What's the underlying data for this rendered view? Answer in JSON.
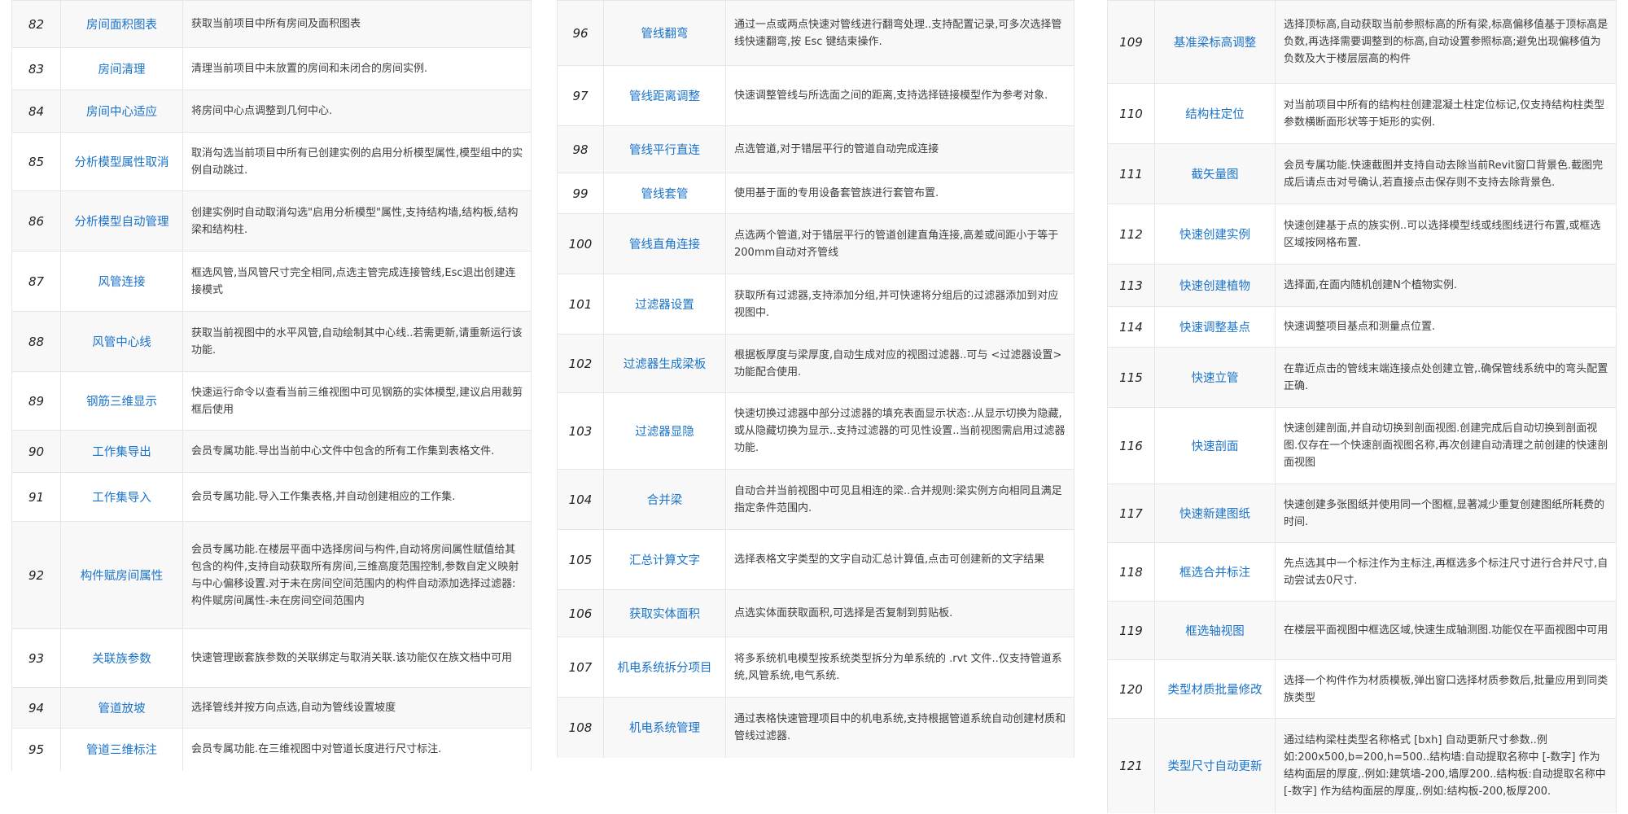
{
  "columns": [
    {
      "rows": [
        {
          "num": "82",
          "name": "房间面积图表",
          "desc": "获取当前项目中所有房间及面积图表"
        },
        {
          "num": "83",
          "name": "房间清理",
          "desc": "清理当前项目中未放置的房间和未闭合的房间实例."
        },
        {
          "num": "84",
          "name": "房间中心适应",
          "desc": "将房间中心点调整到几何中心."
        },
        {
          "num": "85",
          "name": "分析模型属性取消",
          "desc": "取消勾选当前项目中所有已创建实例的启用分析模型属性,模型组中的实例自动跳过."
        },
        {
          "num": "86",
          "name": "分析模型自动管理",
          "desc": "创建实例时自动取消勾选\"启用分析模型\"属性,支持结构墙,结构板,结构梁和结构柱."
        },
        {
          "num": "87",
          "name": "风管连接",
          "desc": "框选风管,当风管尺寸完全相同,点选主管完成连接管线,Esc退出创建连接模式"
        },
        {
          "num": "88",
          "name": "风管中心线",
          "desc": "获取当前视图中的水平风管,自动绘制其中心线..若需更新,请重新运行该功能."
        },
        {
          "num": "89",
          "name": "钢筋三维显示",
          "desc": "快速运行命令以查看当前三维视图中可见钢筋的实体模型,建议启用裁剪框后使用"
        },
        {
          "num": "90",
          "name": "工作集导出",
          "desc": "会员专属功能.导出当前中心文件中包含的所有工作集到表格文件."
        },
        {
          "num": "91",
          "name": "工作集导入",
          "desc": "会员专属功能.导入工作集表格,并自动创建相应的工作集."
        },
        {
          "num": "92",
          "name": "构件赋房间属性",
          "desc": "会员专属功能.在楼层平面中选择房间与构件,自动将房间属性赋值给其包含的构件,支持自动获取所有房间,三维高度范围控制,参数自定义映射与中心偏移设置.对于未在房间空间范围内的构件自动添加选择过滤器:构件赋房间属性-未在房间空间范围内"
        },
        {
          "num": "93",
          "name": "关联族参数",
          "desc": "快速管理嵌套族参数的关联绑定与取消关联.该功能仅在族文档中可用"
        },
        {
          "num": "94",
          "name": "管道放坡",
          "desc": "选择管线并按方向点选,自动为管线设置坡度"
        },
        {
          "num": "95",
          "name": "管道三维标注",
          "desc": "会员专属功能.在三维视图中对管道长度进行尺寸标注."
        }
      ]
    },
    {
      "rows": [
        {
          "num": "96",
          "name": "管线翻弯",
          "desc": "通过一点或两点快速对管线进行翻弯处理..支持配置记录,可多次选择管线快速翻弯,按 Esc 键结束操作."
        },
        {
          "num": "97",
          "name": "管线距离调整",
          "desc": "快速调整管线与所选面之间的距离,支持选择链接模型作为参考对象."
        },
        {
          "num": "98",
          "name": "管线平行直连",
          "desc": "点选管道,对于错层平行的管道自动完成连接"
        },
        {
          "num": "99",
          "name": "管线套管",
          "desc": "使用基于面的专用设备套管族进行套管布置."
        },
        {
          "num": "100",
          "name": "管线直角连接",
          "desc": "点选两个管道,对于错层平行的管道创建直角连接,高差或间距小于等于200mm自动对齐管线"
        },
        {
          "num": "101",
          "name": "过滤器设置",
          "desc": "获取所有过滤器,支持添加分组,并可快速将分组后的过滤器添加到对应视图中."
        },
        {
          "num": "102",
          "name": "过滤器生成梁板",
          "desc": "根据板厚度与梁厚度,自动生成对应的视图过滤器..可与 <过滤器设置> 功能配合使用."
        },
        {
          "num": "103",
          "name": "过滤器显隐",
          "desc": "快速切换过滤器中部分过滤器的填充表面显示状态:.从显示切换为隐藏,或从隐藏切换为显示..支持过滤器的可见性设置..当前视图需启用过滤器功能."
        },
        {
          "num": "104",
          "name": "合并梁",
          "desc": "自动合并当前视图中可见且相连的梁..合并规则:梁实例方向相同且满足指定条件范围内."
        },
        {
          "num": "105",
          "name": "汇总计算文字",
          "desc": "选择表格文字类型的文字自动汇总计算值,点击可创建新的文字结果"
        },
        {
          "num": "106",
          "name": "获取实体面积",
          "desc": "点选实体面获取面积,可选择是否复制到剪贴板."
        },
        {
          "num": "107",
          "name": "机电系统拆分项目",
          "desc": "将多系统机电模型按系统类型拆分为单系统的 .rvt 文件..仅支持管道系统,风管系统,电气系统."
        },
        {
          "num": "108",
          "name": "机电系统管理",
          "desc": "通过表格快速管理项目中的机电系统,支持根据管道系统自动创建材质和管线过滤器."
        }
      ]
    },
    {
      "rows": [
        {
          "num": "109",
          "name": "基准梁标高调整",
          "desc": "选择顶标高,自动获取当前参照标高的所有梁,标高偏移值基于顶标高是负数,再选择需要调整到的标高,自动设置参照标高;避免出现偏移值为负数及大于楼层层高的构件"
        },
        {
          "num": "110",
          "name": "结构柱定位",
          "desc": "对当前项目中所有的结构柱创建混凝土柱定位标记,仅支持结构柱类型参数横断面形状等于矩形的实例."
        },
        {
          "num": "111",
          "name": "截矢量图",
          "desc": "会员专属功能.快速截图并支持自动去除当前Revit窗口背景色.截图完成后请点击对号确认,若直接点击保存则不支持去除背景色."
        },
        {
          "num": "112",
          "name": "快速创建实例",
          "desc": "快速创建基于点的族实例..可以选择模型线或线图线进行布置,或框选区域按网格布置."
        },
        {
          "num": "113",
          "name": "快速创建植物",
          "desc": "选择面,在面内随机创建N个植物实例."
        },
        {
          "num": "114",
          "name": "快速调整基点",
          "desc": "快速调整项目基点和测量点位置."
        },
        {
          "num": "115",
          "name": "快速立管",
          "desc": "在靠近点击的管线末端连接点处创建立管,.确保管线系统中的弯头配置正确."
        },
        {
          "num": "116",
          "name": "快速剖面",
          "desc": "快速创建剖面,并自动切换到剖面视图.创建完成后自动切换到剖面视图.仅存在一个快速剖面视图名称,再次创建自动清理之前创建的快速剖面视图"
        },
        {
          "num": "117",
          "name": "快速新建图纸",
          "desc": "快速创建多张图纸并使用同一个图框,显著减少重复创建图纸所耗费的时间."
        },
        {
          "num": "118",
          "name": "框选合并标注",
          "desc": "先点选其中一个标注作为主标注,再框选多个标注尺寸进行合并尺寸,自动尝试去0尺寸."
        },
        {
          "num": "119",
          "name": "框选轴视图",
          "desc": "在楼层平面视图中框选区域,快速生成轴测图.功能仅在平面视图中可用"
        },
        {
          "num": "120",
          "name": "类型材质批量修改",
          "desc": "选择一个构件作为材质模板,弹出窗口选择材质参数后,批量应用到同类族类型"
        },
        {
          "num": "121",
          "name": "类型尺寸自动更新",
          "desc": "通过结构梁柱类型名称格式 [bxh] 自动更新尺寸参数..例如:200x500,b=200,h=500..结构墙:自动提取名称中 [-数字] 作为结构面层的厚度,.例如:建筑墙-200,墙厚200..结构板:自动提取名称中 [-数字] 作为结构面层的厚度,.例如:结构板-200,板厚200."
        }
      ]
    }
  ]
}
